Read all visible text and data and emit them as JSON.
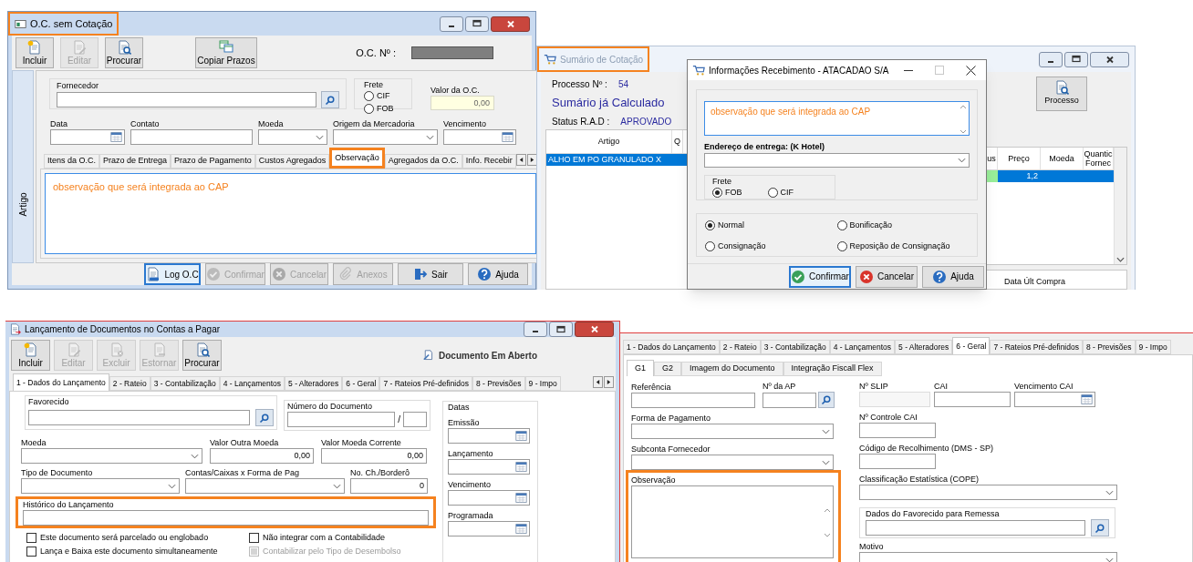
{
  "oc_window": {
    "title": "O.C. sem Cotação",
    "title_highlighted": true,
    "toolbar": [
      {
        "label": "Incluir",
        "kind": "new",
        "disabled": false
      },
      {
        "label": "Editar",
        "kind": "edit",
        "disabled": true
      },
      {
        "label": "Procurar",
        "kind": "search",
        "disabled": false
      }
    ],
    "copy_button": "Copiar Prazos",
    "number_label": "O.C. Nº :",
    "side_tab": "Artigo",
    "supplier_label": "Fornecedor",
    "freight": {
      "label": "Frete",
      "options": [
        {
          "label": "CIF",
          "selected": false
        },
        {
          "label": "FOB",
          "selected": false
        }
      ]
    },
    "total": {
      "label": "Valor da O.C.",
      "value": "0,00"
    },
    "fields": [
      {
        "label": "Data",
        "kind": "date"
      },
      {
        "label": "Contato",
        "kind": "text"
      },
      {
        "label": "Moeda",
        "kind": "select"
      },
      {
        "label": "Origem da Mercadoria",
        "kind": "select"
      },
      {
        "label": "Vencimento",
        "kind": "date"
      }
    ],
    "tabs": [
      {
        "label": "Itens da O.C.",
        "selected": false,
        "highlighted": false
      },
      {
        "label": "Prazo de Entrega",
        "selected": false,
        "highlighted": false
      },
      {
        "label": "Prazo de Pagamento",
        "selected": false,
        "highlighted": false
      },
      {
        "label": "Custos Agregados",
        "selected": false,
        "highlighted": false
      },
      {
        "label": "Observação",
        "selected": true,
        "highlighted": true
      },
      {
        "label": "Agregados da O.C.",
        "selected": false,
        "highlighted": false
      },
      {
        "label": "Info. Recebir",
        "selected": false,
        "highlighted": false
      }
    ],
    "observation": "observação que será integrada ao CAP",
    "buttons": [
      {
        "label": "Log O.C",
        "kind": "log",
        "disabled": false,
        "focused": true
      },
      {
        "label": "Confirmar",
        "kind": "confirm",
        "disabled": true,
        "focused": false
      },
      {
        "label": "Cancelar",
        "kind": "cancel",
        "disabled": true,
        "focused": false
      },
      {
        "label": "Anexos",
        "kind": "attach",
        "disabled": true,
        "focused": false
      },
      {
        "label": "Sair",
        "kind": "exit",
        "disabled": false,
        "focused": false
      },
      {
        "label": "Ajuda",
        "kind": "help",
        "disabled": false,
        "focused": false
      }
    ]
  },
  "summary_window": {
    "title": "Sumário de Cotação",
    "title_highlighted": true,
    "process_label": "Processo Nº :",
    "process_number": "54",
    "heading": "Sumário já Calculado",
    "status_label": "Status R.A.D :",
    "status_value": "APROVADO",
    "process_button": "Processo",
    "items_grid": {
      "columns": [
        "Artigo",
        "Q"
      ],
      "rows": [
        {
          "article": "ALHO EM PO GRANULADO X",
          "selected": true
        }
      ]
    },
    "price_grid": {
      "columns": [
        "us",
        "Preço",
        "Moeda",
        "Quantic Fornec"
      ],
      "rows": [
        {
          "color": "#99ee99",
          "price": "1,2",
          "selected": true
        }
      ]
    },
    "last_purchase_label": "Data Últ Compra"
  },
  "receipt_dialog": {
    "title": "Informações Recebimento - ATACADAO S/A",
    "observation": "observação que será integrada ao CAP",
    "address_label": "Endereço de entrega: (K Hotel)",
    "freight": {
      "label": "Frete",
      "options": [
        {
          "label": "FOB",
          "selected": true
        },
        {
          "label": "CIF",
          "selected": false
        }
      ]
    },
    "types": [
      {
        "label": "Normal",
        "selected": true
      },
      {
        "label": "Bonificação",
        "selected": false
      },
      {
        "label": "Consignação",
        "selected": false
      },
      {
        "label": "Reposição de Consignação",
        "selected": false
      }
    ],
    "buttons": [
      {
        "label": "Confirmar",
        "kind": "confirm",
        "focused": true
      },
      {
        "label": "Cancelar",
        "kind": "cancel",
        "focused": false
      },
      {
        "label": "Ajuda",
        "kind": "help",
        "focused": false
      }
    ]
  },
  "launch_window": {
    "title": "Lançamento de Documentos no Contas a Pagar",
    "toolbar": [
      {
        "label": "Incluir",
        "kind": "new",
        "disabled": false
      },
      {
        "label": "Editar",
        "kind": "edit",
        "disabled": true
      },
      {
        "label": "Excluir",
        "kind": "delete",
        "disabled": true
      },
      {
        "label": "Estornar",
        "kind": "reverse",
        "disabled": true
      },
      {
        "label": "Procurar",
        "kind": "search",
        "disabled": false
      }
    ],
    "document_status": "Documento Em Aberto",
    "tabs": [
      {
        "label": "1 - Dados do Lançamento",
        "selected": true
      },
      {
        "label": "2 - Rateio",
        "selected": false
      },
      {
        "label": "3 - Contabilização",
        "selected": false
      },
      {
        "label": "4 - Lançamentos",
        "selected": false
      },
      {
        "label": "5 - Alteradores",
        "selected": false
      },
      {
        "label": "6 - Geral",
        "selected": false
      },
      {
        "label": "7 - Rateios Pré-definidos",
        "selected": false
      },
      {
        "label": "8 - Previsões",
        "selected": false
      },
      {
        "label": "9 - Impo",
        "selected": false
      }
    ],
    "payee_label": "Favorecido",
    "document_number_label": "Número do Documento",
    "number_separator": "/",
    "dates": {
      "label": "Datas",
      "fields": [
        "Emissão",
        "Lançamento",
        "Vencimento",
        "Programada"
      ]
    },
    "value_rows": [
      [
        {
          "label": "Moeda",
          "kind": "select"
        },
        {
          "label": "Valor Outra Moeda",
          "kind": "number",
          "value": "0,00"
        },
        {
          "label": "Valor Moeda Corrente",
          "kind": "number",
          "value": "0,00"
        }
      ],
      [
        {
          "label": "Tipo de Documento",
          "kind": "select"
        },
        {
          "label": "Contas/Caixas x Forma de Pag",
          "kind": "select"
        },
        {
          "label": "No. Ch./Borderô",
          "kind": "number",
          "value": "0"
        }
      ]
    ],
    "history": {
      "label": "Histórico do Lançamento",
      "highlighted": true
    },
    "checkboxes": [
      {
        "label": "Este documento será parcelado ou englobado",
        "checked": false,
        "disabled": false
      },
      {
        "label": "Não integrar com a Contabilidade",
        "checked": false,
        "disabled": false
      },
      {
        "label": "Lança e Baixa este documento simultaneamente",
        "checked": false,
        "disabled": false
      },
      {
        "label": "Contabilizar pelo Tipo de Desembolso",
        "checked": false,
        "disabled": true
      }
    ]
  },
  "general_tab": {
    "tabs": [
      {
        "label": "1 - Dados do Lançamento",
        "selected": false
      },
      {
        "label": "2 - Rateio",
        "selected": false
      },
      {
        "label": "3 - Contabilização",
        "selected": false
      },
      {
        "label": "4 - Lançamentos",
        "selected": false
      },
      {
        "label": "5 - Alteradores",
        "selected": false
      },
      {
        "label": "6 - Geral",
        "selected": true
      },
      {
        "label": "7 - Rateios Pré-definidos",
        "selected": false
      },
      {
        "label": "8 - Previsões",
        "selected": false
      },
      {
        "label": "9 - Impo",
        "selected": false
      }
    ],
    "subtabs": [
      {
        "label": "G1",
        "selected": true
      },
      {
        "label": "G2",
        "selected": false
      },
      {
        "label": "Imagem do Documento",
        "selected": false
      },
      {
        "label": "Integração Fiscall Flex",
        "selected": false
      }
    ],
    "reference_label": "Referência",
    "ap_label": "Nº da AP",
    "slip": {
      "label": "Nº SLIP",
      "disabled": true
    },
    "cai_label": "CAI",
    "cai_due_label": "Vencimento CAI",
    "payment_label": "Forma de Pagamento",
    "cai_control_label": "Nº Controle CAI",
    "subaccount_label": "Subconta Fornecedor",
    "collection_code_label": "Código de Recolhimento (DMS - SP)",
    "observation": {
      "label": "Observação",
      "highlighted": true
    },
    "classification_label": "Classificação Estatística (COPE)",
    "payee_group_label": "Dados do Favorecido para Remessa",
    "reason_label": "Motivo"
  }
}
